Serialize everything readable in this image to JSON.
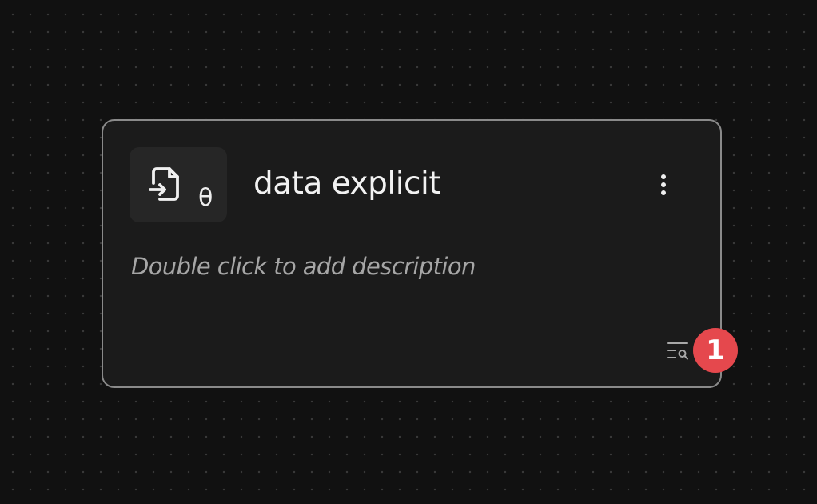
{
  "node": {
    "title": "data explicit",
    "type_glyph": "θ",
    "description_placeholder": "Double click to add description",
    "icon": "file-input-icon",
    "menu_icon": "vertical-ellipsis-icon",
    "inspect_icon": "list-search-icon",
    "output_count": "1"
  },
  "colors": {
    "canvas_background": "#111111",
    "card_background": "#1b1b1b",
    "card_border": "#8a8a8a",
    "badge": "#e5484d",
    "muted_text": "#a6a6a6"
  }
}
